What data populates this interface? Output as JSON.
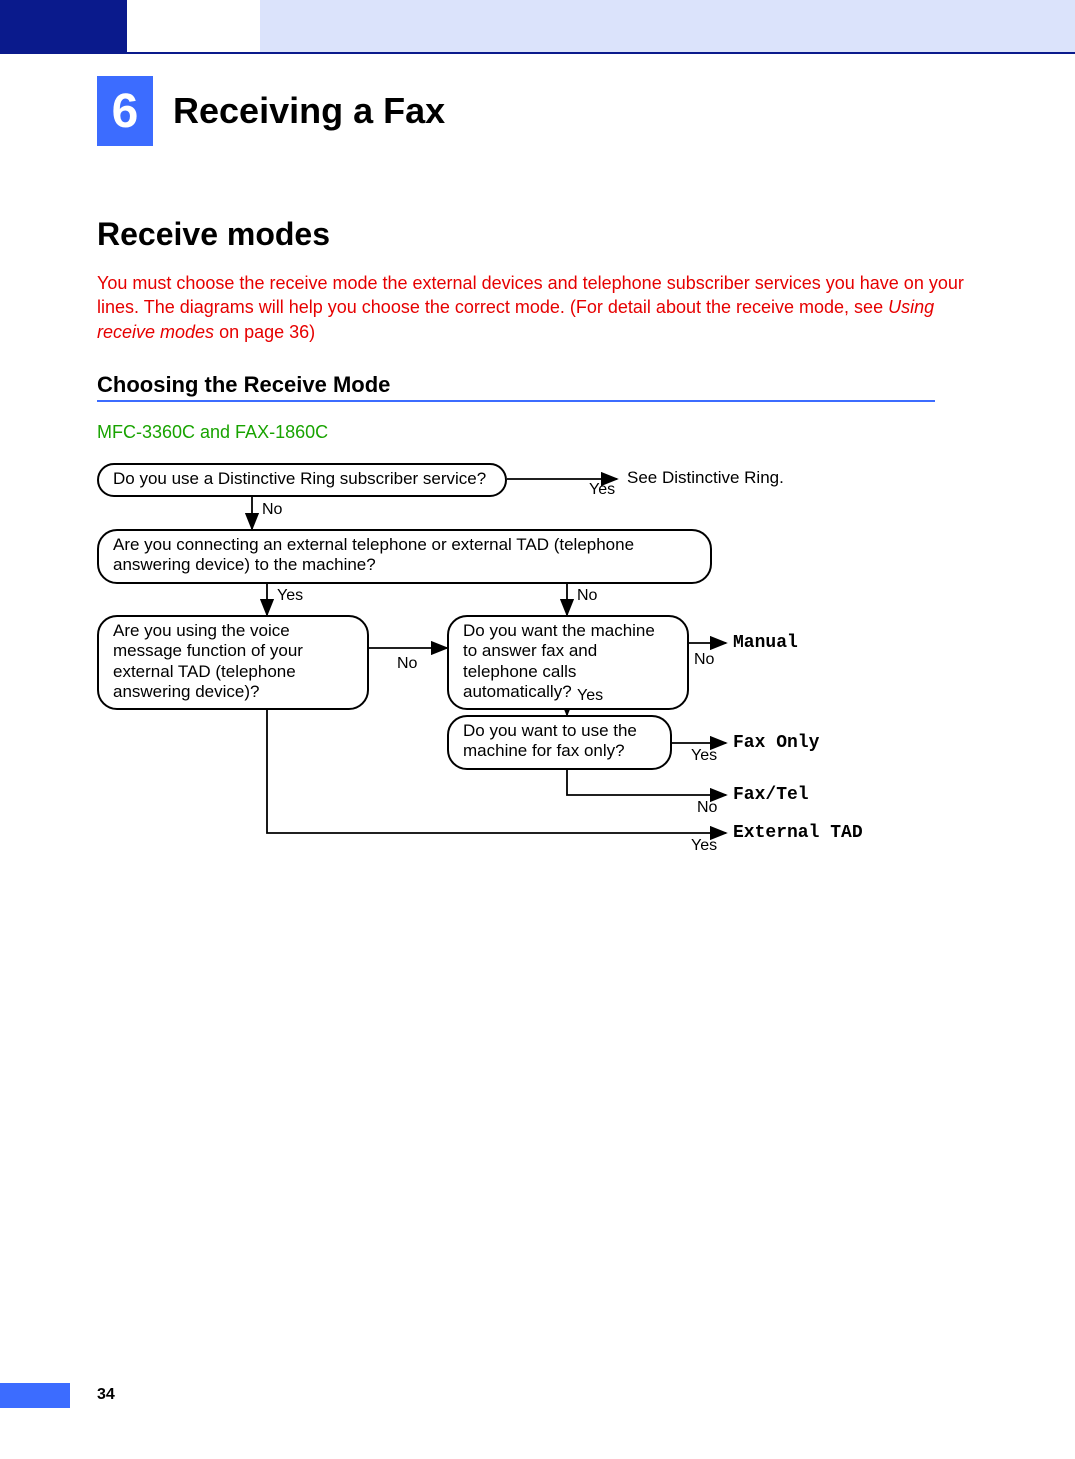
{
  "page_number": "34",
  "chapter": {
    "number": "6",
    "title": "Receiving a Fax"
  },
  "section": {
    "heading": "Receive modes",
    "intro_pre": "You must choose the receive mode the external devices and telephone subscriber services you have on your lines. The diagrams will help you choose the correct mode. (For detail about the receive mode, see ",
    "intro_link": "Using receive modes",
    "intro_post": " on page 36)"
  },
  "subheading": "Choosing the Receive Mode",
  "models": "MFC-3360C and FAX-1860C",
  "flow": {
    "q1": "Do you use a Distinctive Ring subscriber service?",
    "q1_yes_out": "See Distinctive Ring.",
    "q2": "Are you connecting an external telephone or external TAD (telephone answering device) to the machine?",
    "q3": "Are you using the voice message function of your external TAD (telephone answering device)?",
    "q4": "Do you want the machine to answer fax and telephone calls automatically?",
    "q5": "Do you want to use the machine for fax only?",
    "modes": {
      "manual": "Manual",
      "fax_only": "Fax Only",
      "fax_tel": "Fax/Tel",
      "external_tad": "External TAD"
    },
    "labels": {
      "yes": "Yes",
      "no": "No"
    }
  },
  "chart_data": {
    "type": "flowchart",
    "title": "Choosing the Receive Mode — MFC-3360C and FAX-1860C",
    "nodes": [
      {
        "id": "q1",
        "type": "decision",
        "text": "Do you use a Distinctive Ring subscriber service?"
      },
      {
        "id": "out_distinctive",
        "type": "terminal",
        "text": "See Distinctive Ring."
      },
      {
        "id": "q2",
        "type": "decision",
        "text": "Are you connecting an external telephone or external TAD (telephone answering device) to the machine?"
      },
      {
        "id": "q3",
        "type": "decision",
        "text": "Are you using the voice message function of your external TAD (telephone answering device)?"
      },
      {
        "id": "q4",
        "type": "decision",
        "text": "Do you want the machine to answer fax and telephone calls automatically?"
      },
      {
        "id": "q5",
        "type": "decision",
        "text": "Do you want to use the machine for fax only?"
      },
      {
        "id": "mode_manual",
        "type": "terminal",
        "text": "Manual"
      },
      {
        "id": "mode_fax_only",
        "type": "terminal",
        "text": "Fax Only"
      },
      {
        "id": "mode_fax_tel",
        "type": "terminal",
        "text": "Fax/Tel"
      },
      {
        "id": "mode_external_tad",
        "type": "terminal",
        "text": "External TAD"
      }
    ],
    "edges": [
      {
        "from": "q1",
        "to": "out_distinctive",
        "label": "Yes"
      },
      {
        "from": "q1",
        "to": "q2",
        "label": "No"
      },
      {
        "from": "q2",
        "to": "q3",
        "label": "Yes"
      },
      {
        "from": "q2",
        "to": "q4",
        "label": "No"
      },
      {
        "from": "q3",
        "to": "q4",
        "label": "No"
      },
      {
        "from": "q3",
        "to": "mode_external_tad",
        "label": "Yes"
      },
      {
        "from": "q4",
        "to": "mode_manual",
        "label": "No"
      },
      {
        "from": "q4",
        "to": "q5",
        "label": "Yes"
      },
      {
        "from": "q5",
        "to": "mode_fax_only",
        "label": "Yes"
      },
      {
        "from": "q5",
        "to": "mode_fax_tel",
        "label": "No"
      }
    ]
  }
}
